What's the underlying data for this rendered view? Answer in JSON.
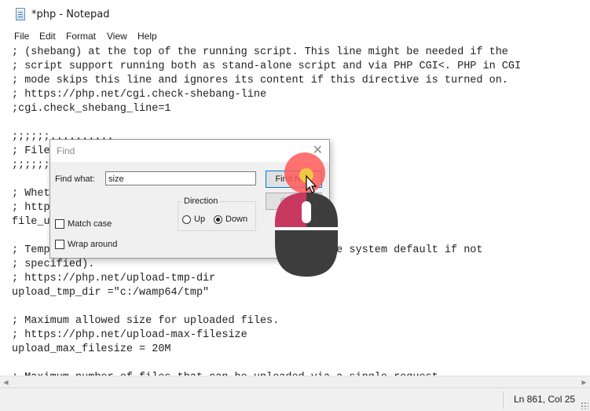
{
  "window": {
    "title": "*php - Notepad"
  },
  "menu": {
    "items": [
      "File",
      "Edit",
      "Format",
      "View",
      "Help"
    ]
  },
  "editor": {
    "lines": [
      "; (shebang) at the top of the running script. This line might be needed if the",
      "; script support running both as stand-alone script and via PHP CGI<. PHP in CGI",
      "; mode skips this line and ignores its content if this directive is turned on.",
      "; https://php.net/cgi.check-shebang-line",
      ";cgi.check_shebang_line=1",
      "",
      ";;;;;;..........",
      "; File",
      ";;;;;;",
      "",
      "; Whet",
      "; http",
      "file_u",
      "",
      "; Temp                                           use system default if not",
      "; specified).",
      "; https://php.net/upload-tmp-dir",
      "upload_tmp_dir =\"c:/wamp64/tmp\"",
      "",
      "; Maximum allowed size for uploaded files.",
      "; https://php.net/upload-max-filesize",
      "upload_max_filesize = 20M",
      "",
      "; Maximum number of files that can be uploaded via a single request"
    ]
  },
  "status": {
    "position": "Ln 861, Col 25"
  },
  "find_dialog": {
    "title": "Find",
    "find_what_label": "Find what:",
    "find_what_value": "size",
    "find_next_label": "Find Next",
    "cancel_label": "Cancel",
    "direction_label": "Direction",
    "up_label": "Up",
    "down_label": "Down",
    "direction_selected": "Down",
    "match_case_label": "Match case",
    "wrap_around_label": "Wrap around",
    "match_case_checked": false,
    "wrap_around_checked": false
  },
  "overlay": {
    "mouse_icon": "mouse-left-click-icon",
    "colors": {
      "mouse_body": "#3d3d3d",
      "mouse_left_button": "#c8375e",
      "mouse_scroll": "#ffffff",
      "click_highlight": "#ff5a5a",
      "click_center": "#f4c542"
    }
  }
}
